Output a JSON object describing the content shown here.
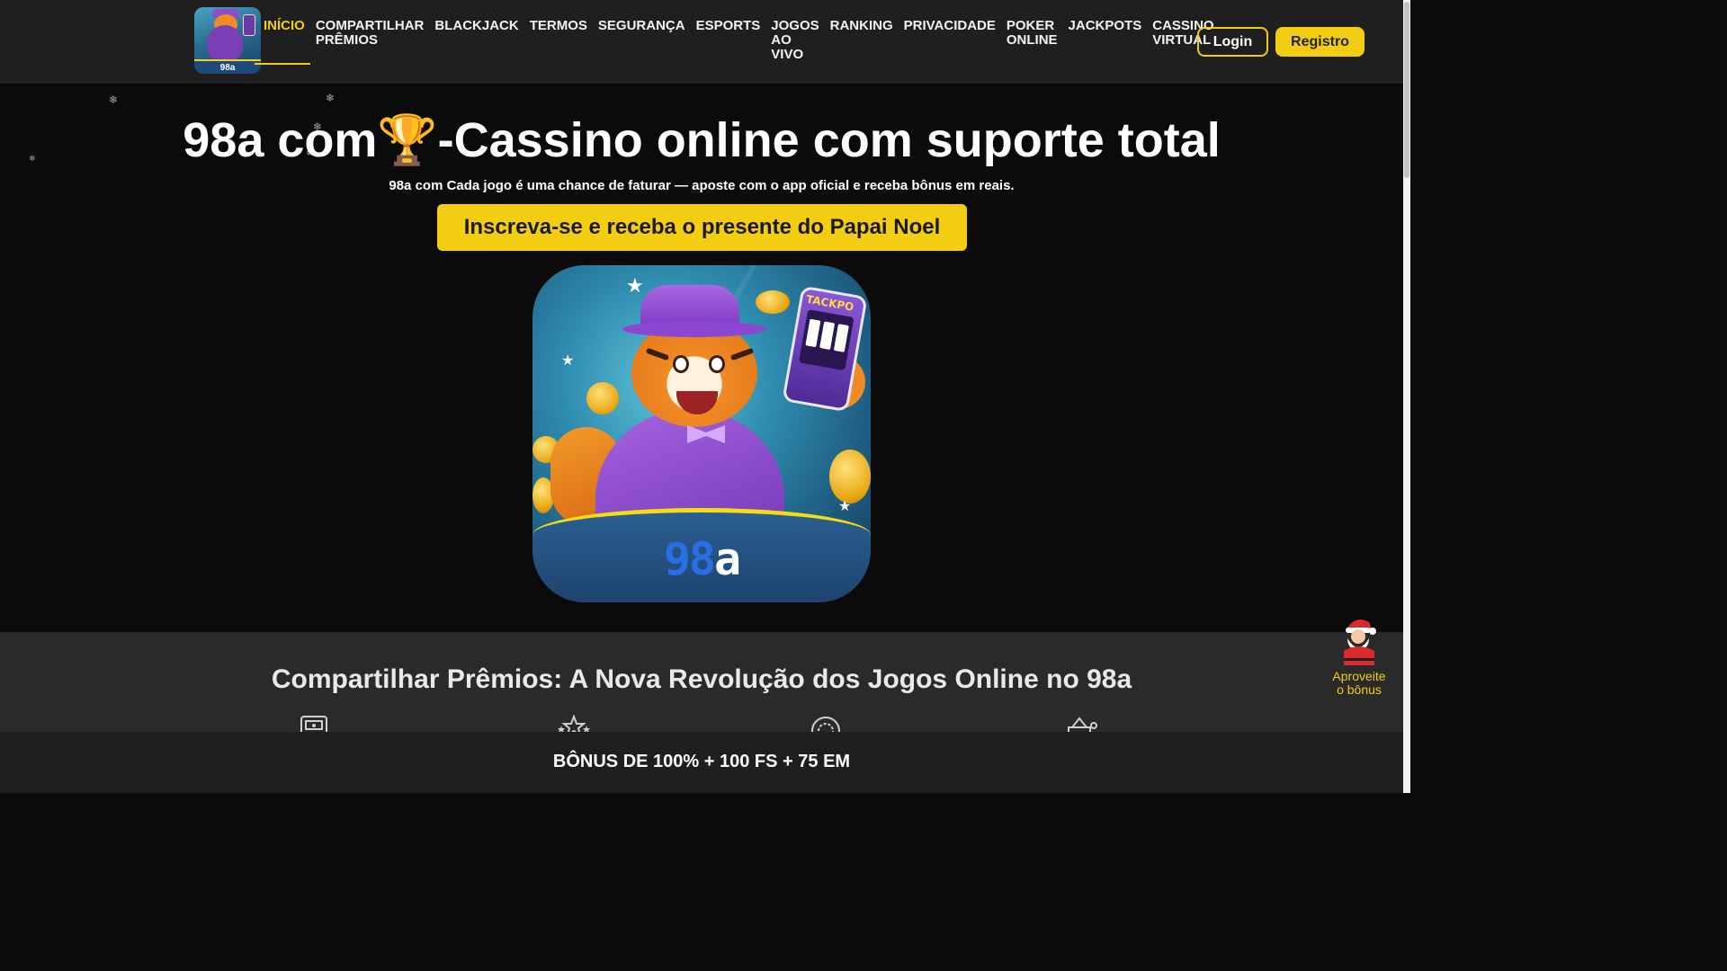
{
  "brand": {
    "logo_text": "98a",
    "icon_brand_nine": "98",
    "icon_brand_a": "a"
  },
  "nav": {
    "items": [
      {
        "label": "INÍCIO",
        "active": true
      },
      {
        "label": "COMPARTILHAR\nPRÊMIOS",
        "active": false
      },
      {
        "label": "BLACKJACK",
        "active": false
      },
      {
        "label": "TERMOS",
        "active": false
      },
      {
        "label": "SEGURANÇA",
        "active": false
      },
      {
        "label": "ESPORTS",
        "active": false
      },
      {
        "label": "JOGOS\nAO\nVIVO",
        "active": false
      },
      {
        "label": "RANKING",
        "active": false
      },
      {
        "label": "PRIVACIDADE",
        "active": false
      },
      {
        "label": "POKER\nONLINE",
        "active": false
      },
      {
        "label": "JACKPOTS",
        "active": false
      },
      {
        "label": "CASSINO\nVIRTUAL",
        "active": false
      }
    ],
    "login_label": "Login",
    "register_label": "Registro"
  },
  "hero": {
    "title_before": "98a com",
    "trophy": "🏆",
    "title_after": "-Cassino online com suporte total",
    "subtitle": "98a com Cada jogo é uma chance de faturar — aposte com o app oficial e receba bônus em reais.",
    "cta_label": "Inscreva-se e receba o presente do Papai Noel",
    "phone_text": "TACKPO"
  },
  "section2": {
    "title": "Compartilhar Prêmios: A Nova Revolução dos Jogos Online no 98a"
  },
  "bonus_bar": {
    "text": "BÔNUS DE 100% + 100 FS + 75 EM"
  },
  "santa_widget": {
    "label": "Aproveite o bônus"
  },
  "colors": {
    "accent": "#f2cd12",
    "header_bg": "#1f1f1f",
    "page_bg": "#0b0b0b",
    "section_bg": "#2a2a2a"
  },
  "icons": [
    "slot-machine-icon",
    "stars-icon",
    "roulette-icon",
    "basket-icon",
    "trophy-icon",
    "snowflake-icon",
    "santa-icon"
  ]
}
